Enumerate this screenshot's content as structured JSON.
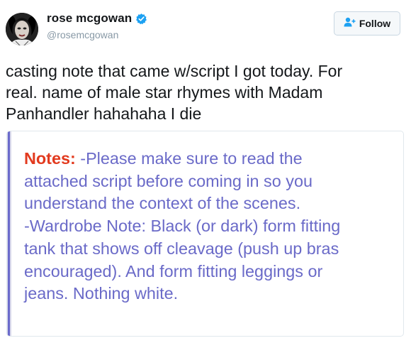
{
  "tweet": {
    "author": {
      "display_name": "rose mcgowan",
      "handle": "@rosemcgowan",
      "verified": true,
      "avatar_icon": "profile-photo"
    },
    "follow_button": {
      "label": "Follow",
      "icon": "add-user-icon"
    },
    "text_lines": [
      "casting note that came w/script I got today. For",
      "real. name of male star rhymes with Madam",
      "Panhandler hahahaha I die"
    ],
    "media": {
      "label": "Notes:",
      "first_line_rest": " -Please make sure to read the",
      "lines": [
        "attached script before coming in so you",
        "understand the context of the scenes.",
        "-Wardrobe Note: Black (or dark) form fitting",
        "tank that shows off cleavage (push up bras",
        "encouraged). And form fitting leggings or",
        "jeans. Nothing white."
      ]
    }
  },
  "colors": {
    "link_blue": "#1da1f2",
    "text": "#14171a",
    "muted": "#8899a6",
    "note_purple": "#6a6ac8",
    "note_red": "#e23a1e"
  }
}
